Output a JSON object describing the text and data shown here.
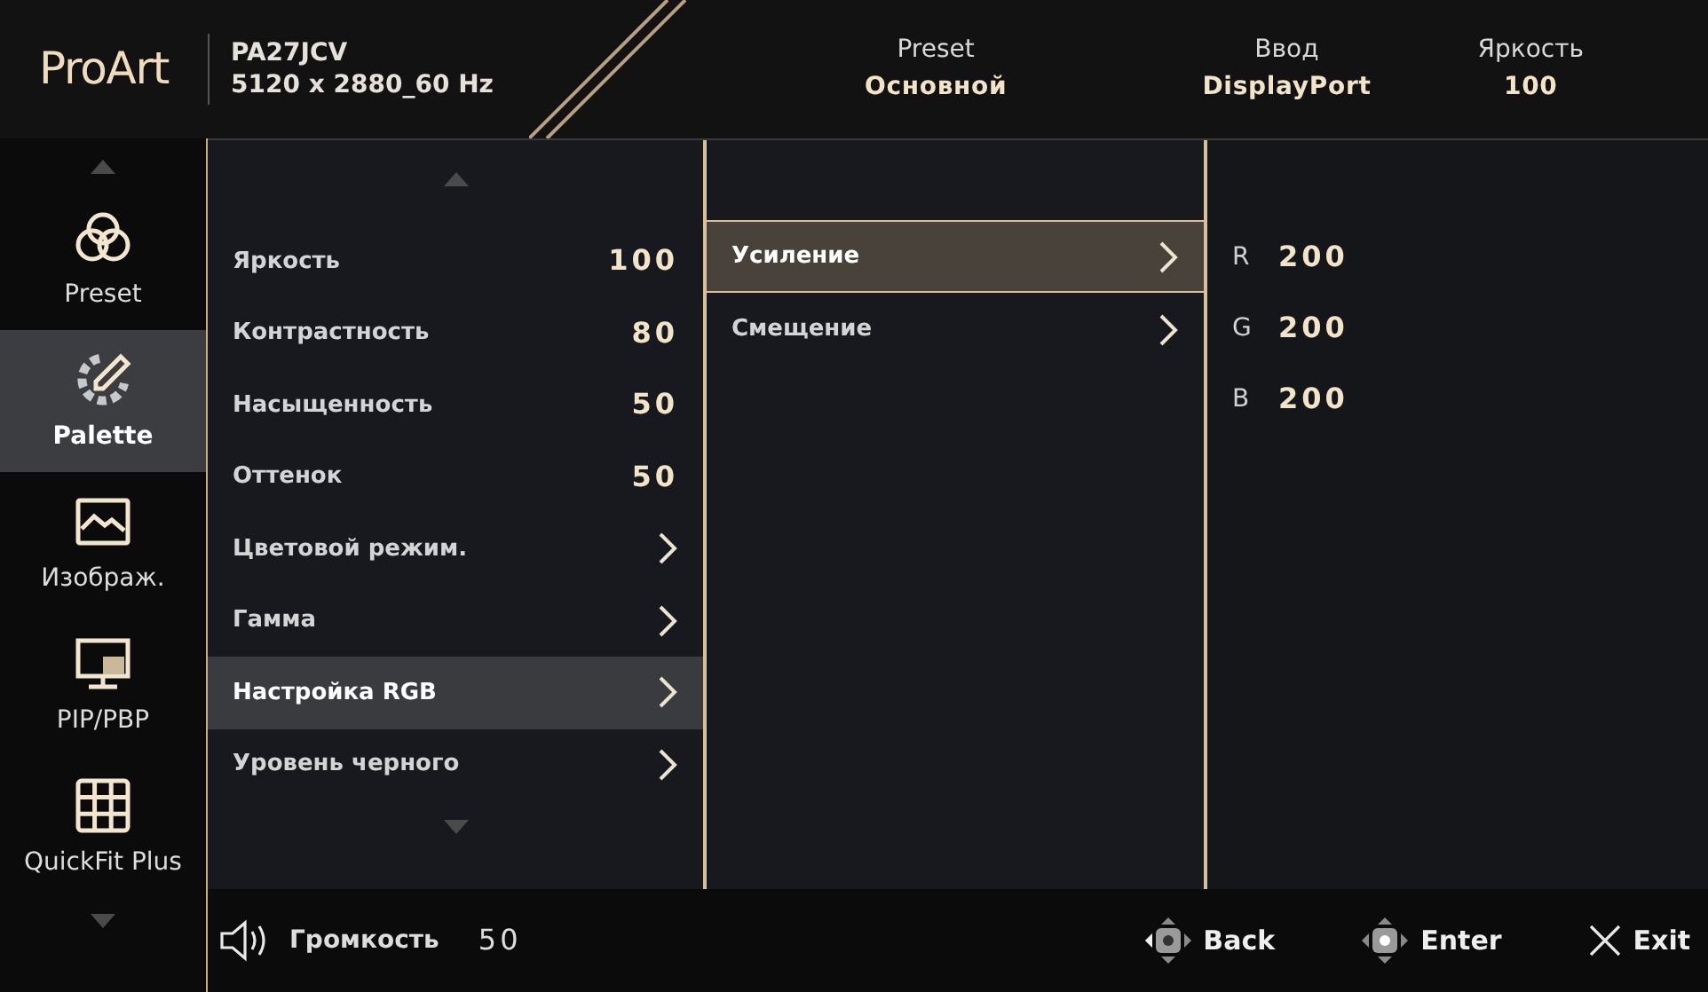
{
  "header": {
    "logo": "ProArt",
    "model": "PA27JCV",
    "resolution": "5120 x 2880_60 Hz",
    "status": [
      {
        "label": "Preset",
        "value": "Основной"
      },
      {
        "label": "Ввод",
        "value": "DisplayPort"
      },
      {
        "label": "Яркость",
        "value": "100"
      }
    ]
  },
  "sidebar": {
    "items": [
      {
        "label": "Preset",
        "kind": "circles",
        "selected": false
      },
      {
        "label": "Palette",
        "kind": "palette",
        "selected": true
      },
      {
        "label": "Изображ.",
        "kind": "image",
        "selected": false
      },
      {
        "label": "PIP/PBP",
        "kind": "monitor",
        "selected": false
      },
      {
        "label": "QuickFit Plus",
        "kind": "grid",
        "selected": false
      }
    ]
  },
  "menu": {
    "items": [
      {
        "label": "Яркость",
        "kind": "value",
        "value": "100",
        "selected": false
      },
      {
        "label": "Контрастность",
        "kind": "value",
        "value": "80",
        "selected": false
      },
      {
        "label": "Насыщенность",
        "kind": "value",
        "value": "50",
        "selected": false
      },
      {
        "label": "Оттенок",
        "kind": "value",
        "value": "50",
        "selected": false
      },
      {
        "label": "Цветовой режим.",
        "kind": "submenu",
        "selected": false
      },
      {
        "label": "Гамма",
        "kind": "submenu",
        "selected": false
      },
      {
        "label": "Настройка RGB",
        "kind": "submenu",
        "selected": true
      },
      {
        "label": "Уровень черного",
        "kind": "submenu",
        "selected": false
      }
    ]
  },
  "submenu": {
    "items": [
      {
        "label": "Усиление",
        "selected": true
      },
      {
        "label": "Смещение",
        "selected": false
      }
    ]
  },
  "values": [
    {
      "channel": "R",
      "value": "200"
    },
    {
      "channel": "G",
      "value": "200"
    },
    {
      "channel": "B",
      "value": "200"
    }
  ],
  "footer": {
    "volume_label": "Громкость",
    "volume_value": "50",
    "actions": [
      {
        "kind": "back",
        "label": "Back"
      },
      {
        "kind": "enter",
        "label": "Enter"
      },
      {
        "kind": "exit",
        "label": "Exit"
      }
    ]
  }
}
